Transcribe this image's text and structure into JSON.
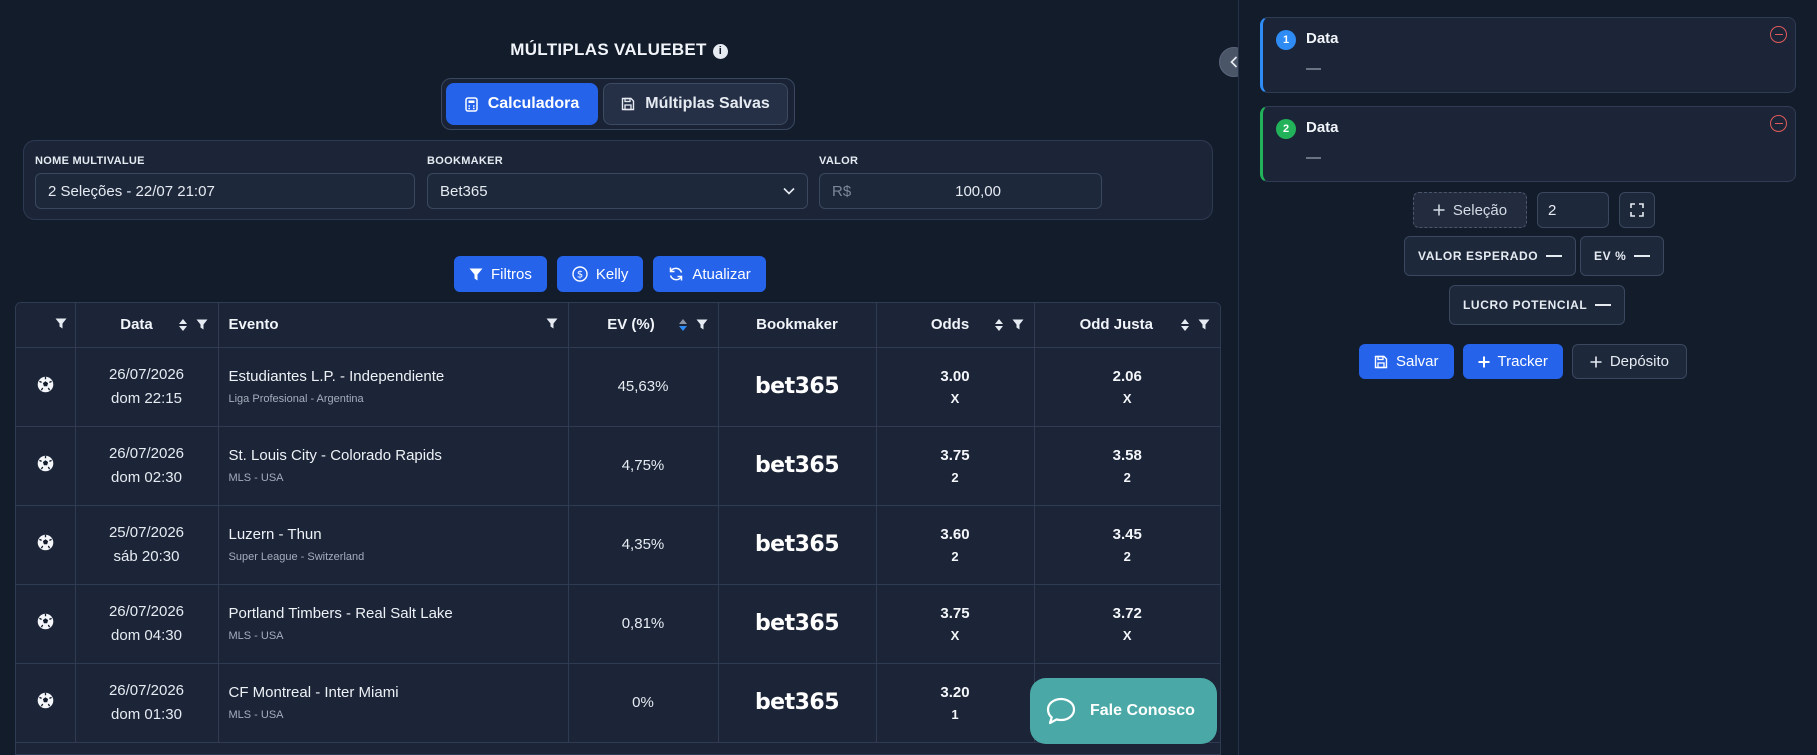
{
  "header": {
    "title": "MÚLTIPLAS VALUEBET",
    "info_glyph": "i"
  },
  "tabs": [
    {
      "label": "Calculadora",
      "icon": "calculator-icon",
      "active": true
    },
    {
      "label": "Múltiplas Salvas",
      "icon": "save-icon",
      "active": false
    }
  ],
  "form": {
    "name_label": "NOME MULTIVALUE",
    "name_value": "2 Seleções - 22/07 21:07",
    "bookmaker_label": "BOOKMAKER",
    "bookmaker_value": "Bet365",
    "valor_label": "VALOR",
    "valor_prefix": "R$",
    "valor_value": "100,00"
  },
  "actions": {
    "filtros": "Filtros",
    "kelly": "Kelly",
    "atualizar": "Atualizar"
  },
  "table": {
    "headers": {
      "data": "Data",
      "evento": "Evento",
      "ev": "EV (%)",
      "bookmaker": "Bookmaker",
      "odds": "Odds",
      "odd_justa": "Odd Justa"
    },
    "rows": [
      {
        "date": "26/07/2026",
        "time": "dom 22:15",
        "event": "Estudiantes L.P. - Independiente",
        "league": "Liga Profesional - Argentina",
        "ev": "45,63%",
        "bookmaker": "bet365",
        "odds": "3.00",
        "odds_mkt": "X",
        "fair": "2.06",
        "fair_mkt": "X"
      },
      {
        "date": "26/07/2026",
        "time": "dom 02:30",
        "event": "St. Louis City - Colorado Rapids",
        "league": "MLS - USA",
        "ev": "4,75%",
        "bookmaker": "bet365",
        "odds": "3.75",
        "odds_mkt": "2",
        "fair": "3.58",
        "fair_mkt": "2"
      },
      {
        "date": "25/07/2026",
        "time": "sáb 20:30",
        "event": "Luzern - Thun",
        "league": "Super League - Switzerland",
        "ev": "4,35%",
        "bookmaker": "bet365",
        "odds": "3.60",
        "odds_mkt": "2",
        "fair": "3.45",
        "fair_mkt": "2"
      },
      {
        "date": "26/07/2026",
        "time": "dom 04:30",
        "event": "Portland Timbers - Real Salt Lake",
        "league": "MLS - USA",
        "ev": "0,81%",
        "bookmaker": "bet365",
        "odds": "3.75",
        "odds_mkt": "X",
        "fair": "3.72",
        "fair_mkt": "X"
      },
      {
        "date": "26/07/2026",
        "time": "dom 01:30",
        "event": "CF Montreal - Inter Miami",
        "league": "MLS - USA",
        "ev": "0%",
        "bookmaker": "bet365",
        "odds": "3.20",
        "odds_mkt": "1",
        "fair": "",
        "fair_mkt": ""
      }
    ]
  },
  "chat": {
    "label": "Fale Conosco"
  },
  "selections": [
    {
      "number": "1",
      "title": "Data",
      "value": "—",
      "color": "#2f8cf5"
    },
    {
      "number": "2",
      "title": "Data",
      "value": "—",
      "color": "#22b35a"
    }
  ],
  "controls": {
    "add_selection": "Seleção",
    "count_value": "2"
  },
  "stats": {
    "expected_value_label": "VALOR ESPERADO",
    "ev_percent_label": "EV %",
    "potential_profit_label": "LUCRO POTENCIAL"
  },
  "right_actions": {
    "salvar": "Salvar",
    "tracker": "Tracker",
    "deposito": "Depósito"
  },
  "colors": {
    "background": "#131c2b",
    "accent": "#2563eb",
    "chat": "#4aa9a6",
    "danger": "#e05a5a"
  }
}
